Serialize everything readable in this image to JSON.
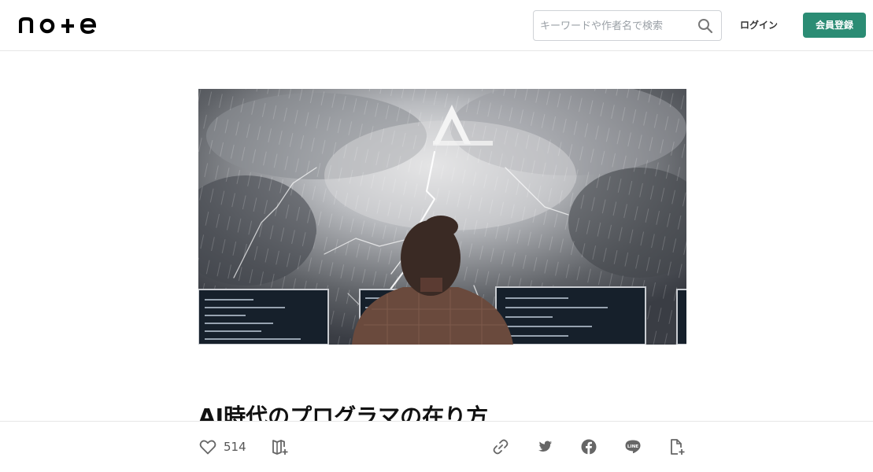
{
  "header": {
    "logo_text": "note",
    "search_placeholder": "キーワードや作者名で検索",
    "login_label": "ログイン",
    "signup_label": "会員登録",
    "accent_color": "#2b8c74"
  },
  "article": {
    "hero_alt": "",
    "title": "AI時代のプログラマの在り方"
  },
  "actions": {
    "like_count": "514",
    "icons": [
      "heart-icon",
      "magazine-add-icon",
      "link-icon",
      "twitter-icon",
      "facebook-icon",
      "line-icon",
      "embed-add-icon"
    ]
  }
}
